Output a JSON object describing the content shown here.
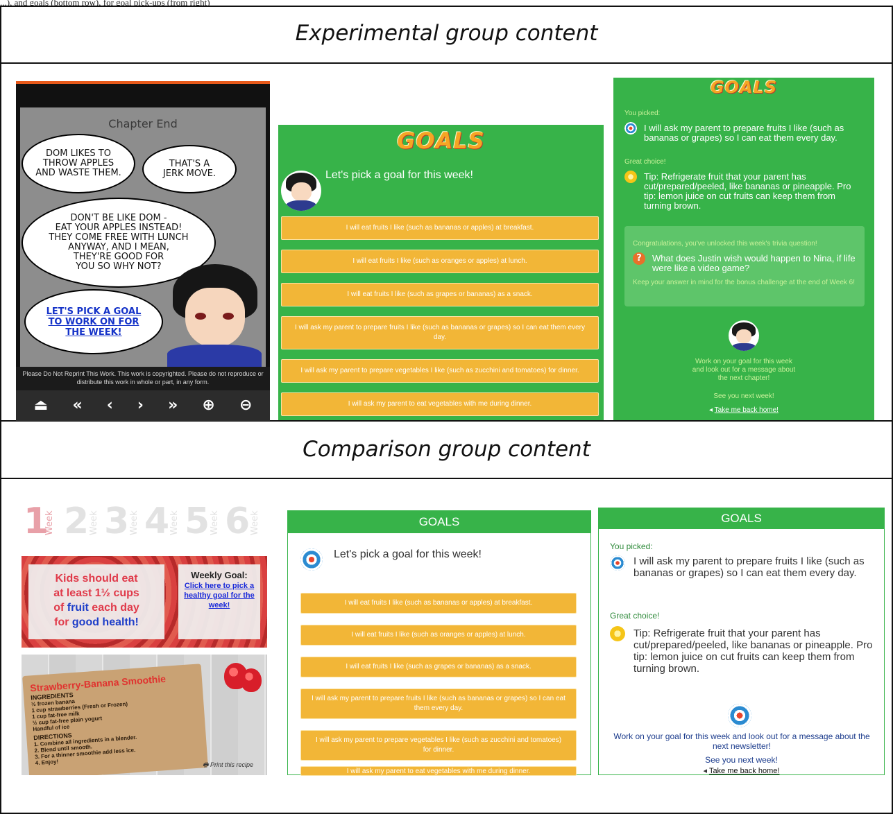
{
  "caption": "...), and goals (bottom row), for goal pick-ups (from right)",
  "sections": {
    "experimental_title": "Experimental group content",
    "comparison_title": "Comparison group content"
  },
  "comic": {
    "chapter_end": "Chapter End",
    "bubble1": [
      "DOM LIKES TO",
      "THROW APPLES",
      "AND WASTE THEM."
    ],
    "bubble2": [
      "THAT'S A",
      "JERK MOVE."
    ],
    "bubble3": [
      "DON'T BE LIKE DOM -",
      "EAT YOUR APPLES INSTEAD!",
      "THEY COME FREE WITH LUNCH",
      "ANYWAY, AND I MEAN,",
      "THEY'RE GOOD FOR",
      "YOU SO WHY NOT?"
    ],
    "link_lines": [
      "LET'S PICK A GOAL",
      "TO WORK ON FOR",
      "THE WEEK!"
    ],
    "copyright": "Please Do Not Reprint This Work. This work is copyrighted. Please do not reproduce or distribute this work in whole or part, in any form.",
    "toolbar": [
      "⏏",
      "«",
      "‹",
      "›",
      "»",
      "⊕",
      "⊖"
    ]
  },
  "exp_goals": {
    "logo": "GOALS",
    "prompt": "Let's pick a goal for this week!",
    "options": [
      "I will eat fruits I like (such as bananas or apples) at breakfast.",
      "I will eat fruits I like (such as oranges or apples) at lunch.",
      "I will eat fruits I like (such as grapes or bananas) as a snack.",
      "I will ask my parent to prepare fruits I like (such as bananas or grapes) so I can eat them every day.",
      "I will ask my parent to prepare vegetables I like (such as zucchini and tomatoes) for dinner.",
      "I will ask my parent to eat vegetables with me during dinner."
    ]
  },
  "exp_picked": {
    "logo": "GOALS",
    "you_picked": "You picked:",
    "picked_goal": "I will ask my parent to prepare fruits I like (such as bananas or grapes) so I can eat them every day.",
    "great_choice": "Great choice!",
    "tip": "Tip: Refrigerate fruit that your parent has cut/prepared/peeled, like bananas or pineapple. Pro tip: lemon juice on cut fruits can keep them from turning brown.",
    "congrats": "Congratulations, you've unlocked this week's trivia question!",
    "trivia": "What does Justin wish would happen to Nina, if life were like a video game?",
    "keep": "Keep your answer in mind for the bonus challenge at the end of Week 6!",
    "work_on": [
      "Work on your goal for this week",
      "and look out for a message about",
      "the next chapter!"
    ],
    "see_you": "See you next week!",
    "home": "Take me back home!"
  },
  "weeks": {
    "numbers": [
      "1",
      "2",
      "3",
      "4",
      "5",
      "6"
    ],
    "label": "Week",
    "active_color": "#e8a0a8"
  },
  "strawberry": {
    "line1": "Kids should eat",
    "line2": "at least 1½ cups",
    "line3_a": "of ",
    "line3_b": "fruit",
    "line3_c": " each day",
    "line4_a": "for ",
    "line4_b": "good health!",
    "weekly_goal": "Weekly Goal:",
    "weekly_link": "Click here to pick a healthy goal for the week!"
  },
  "recipe": {
    "title": "Strawberry-Banana Smoothie",
    "ingredients_h": "INGREDIENTS",
    "ingredients": [
      "½ frozen banana",
      "1 cup strawberries (Fresh or Frozen)",
      "1 cup fat-free milk",
      "½ cup fat-free plain yogurt",
      "Handful of ice"
    ],
    "directions_h": "DIRECTIONS",
    "directions": [
      "1. Combine all ingredients in a blender.",
      "2. Blend until smooth.",
      "3. For a thinner smoothie add less ice.",
      "4. Enjoy!"
    ],
    "print": "Print this recipe"
  },
  "cmp_goals": {
    "header": "GOALS",
    "prompt": "Let's pick a goal for this week!",
    "options": [
      "I will eat fruits I like (such as bananas or apples) at breakfast.",
      "I will eat fruits I like (such as oranges or apples) at lunch.",
      "I will eat fruits I like (such as grapes or bananas) as a snack.",
      "I will ask my parent to prepare fruits I like (such as bananas or grapes) so I can eat them every day.",
      "I will ask my parent to prepare vegetables I like (such as zucchini and tomatoes) for dinner.",
      "I will ask my parent to eat vegetables with me during dinner."
    ]
  },
  "cmp_picked": {
    "header": "GOALS",
    "you_picked": "You picked:",
    "picked_goal": "I will ask my parent to prepare fruits I like (such as bananas or grapes) so I can eat them every day.",
    "great_choice": "Great choice!",
    "tip": "Tip: Refrigerate fruit that your parent has cut/prepared/peeled, like bananas or pineapple. Pro tip: lemon juice on cut fruits can keep them from turning brown.",
    "work_on": "Work on your goal for this week and look out for a message about the next newsletter!",
    "see_you": "See you next week!",
    "home": "Take me back home!"
  },
  "colors": {
    "goal_green": "#37b349",
    "goal_button": "#f2b637",
    "comic_accent": "#e85a1b"
  }
}
